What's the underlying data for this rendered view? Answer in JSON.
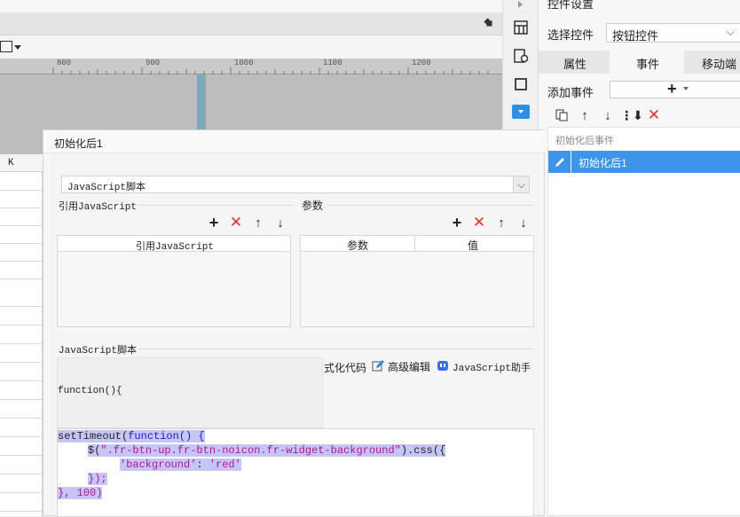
{
  "ruler": {
    "ticks": [
      "800",
      "900",
      "1000",
      "1100",
      "1200"
    ]
  },
  "grid": {
    "col_label": "K"
  },
  "right_panel": {
    "title": "控件设置",
    "select_label": "选择控件",
    "select_value": "按钮控件",
    "tabs": [
      "属性",
      "事件",
      "移动端"
    ],
    "add_event_label": "添加事件",
    "group_label": "初始化后事件",
    "event_item": "初始化后1"
  },
  "dialog": {
    "title": "初始化后1",
    "script_type": "JavaScript脚本",
    "ref_js_section": "引用JavaScript",
    "params_section": "参数",
    "ref_js_col": "引用JavaScript",
    "param_col": "参数",
    "value_col": "值",
    "script_section": "JavaScript脚本",
    "format_code": "式化代码",
    "advanced_edit": "高级编辑",
    "js_helper": "JavaScript助手",
    "function_header": "function(){",
    "code": {
      "l1a": "setTimeout(",
      "l1b": "function",
      "l1c": "() {",
      "l2a": "$(",
      "l2b": "\".fr-btn-up.fr-btn-noicon.fr-widget-background\"",
      "l2c": ").css({",
      "l3a": "'background'",
      "l3b": ": ",
      "l3c": "'red'",
      "l4": "});",
      "l5": "}, 100)"
    }
  }
}
